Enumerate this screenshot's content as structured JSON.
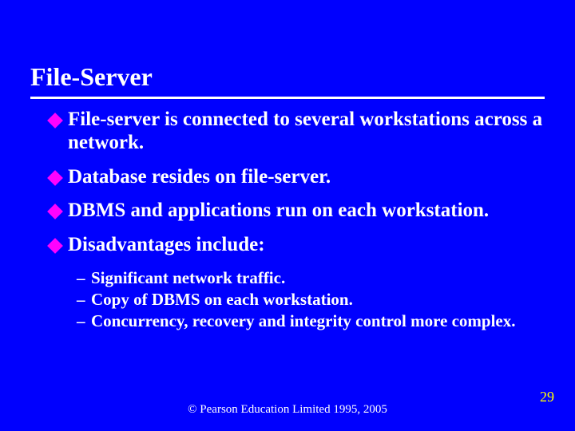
{
  "title": "File-Server",
  "bullets": [
    {
      "text": "File-server is connected to several workstations across a network."
    },
    {
      "text": "Database resides on file-server."
    },
    {
      "text": "DBMS and applications run on each workstation."
    },
    {
      "text": "Disadvantages include:",
      "sub": [
        "Significant network traffic.",
        "Copy of DBMS on each workstation.",
        "Concurrency, recovery and integrity control more complex."
      ]
    }
  ],
  "footer": "© Pearson Education Limited 1995, 2005",
  "page_number": "29"
}
